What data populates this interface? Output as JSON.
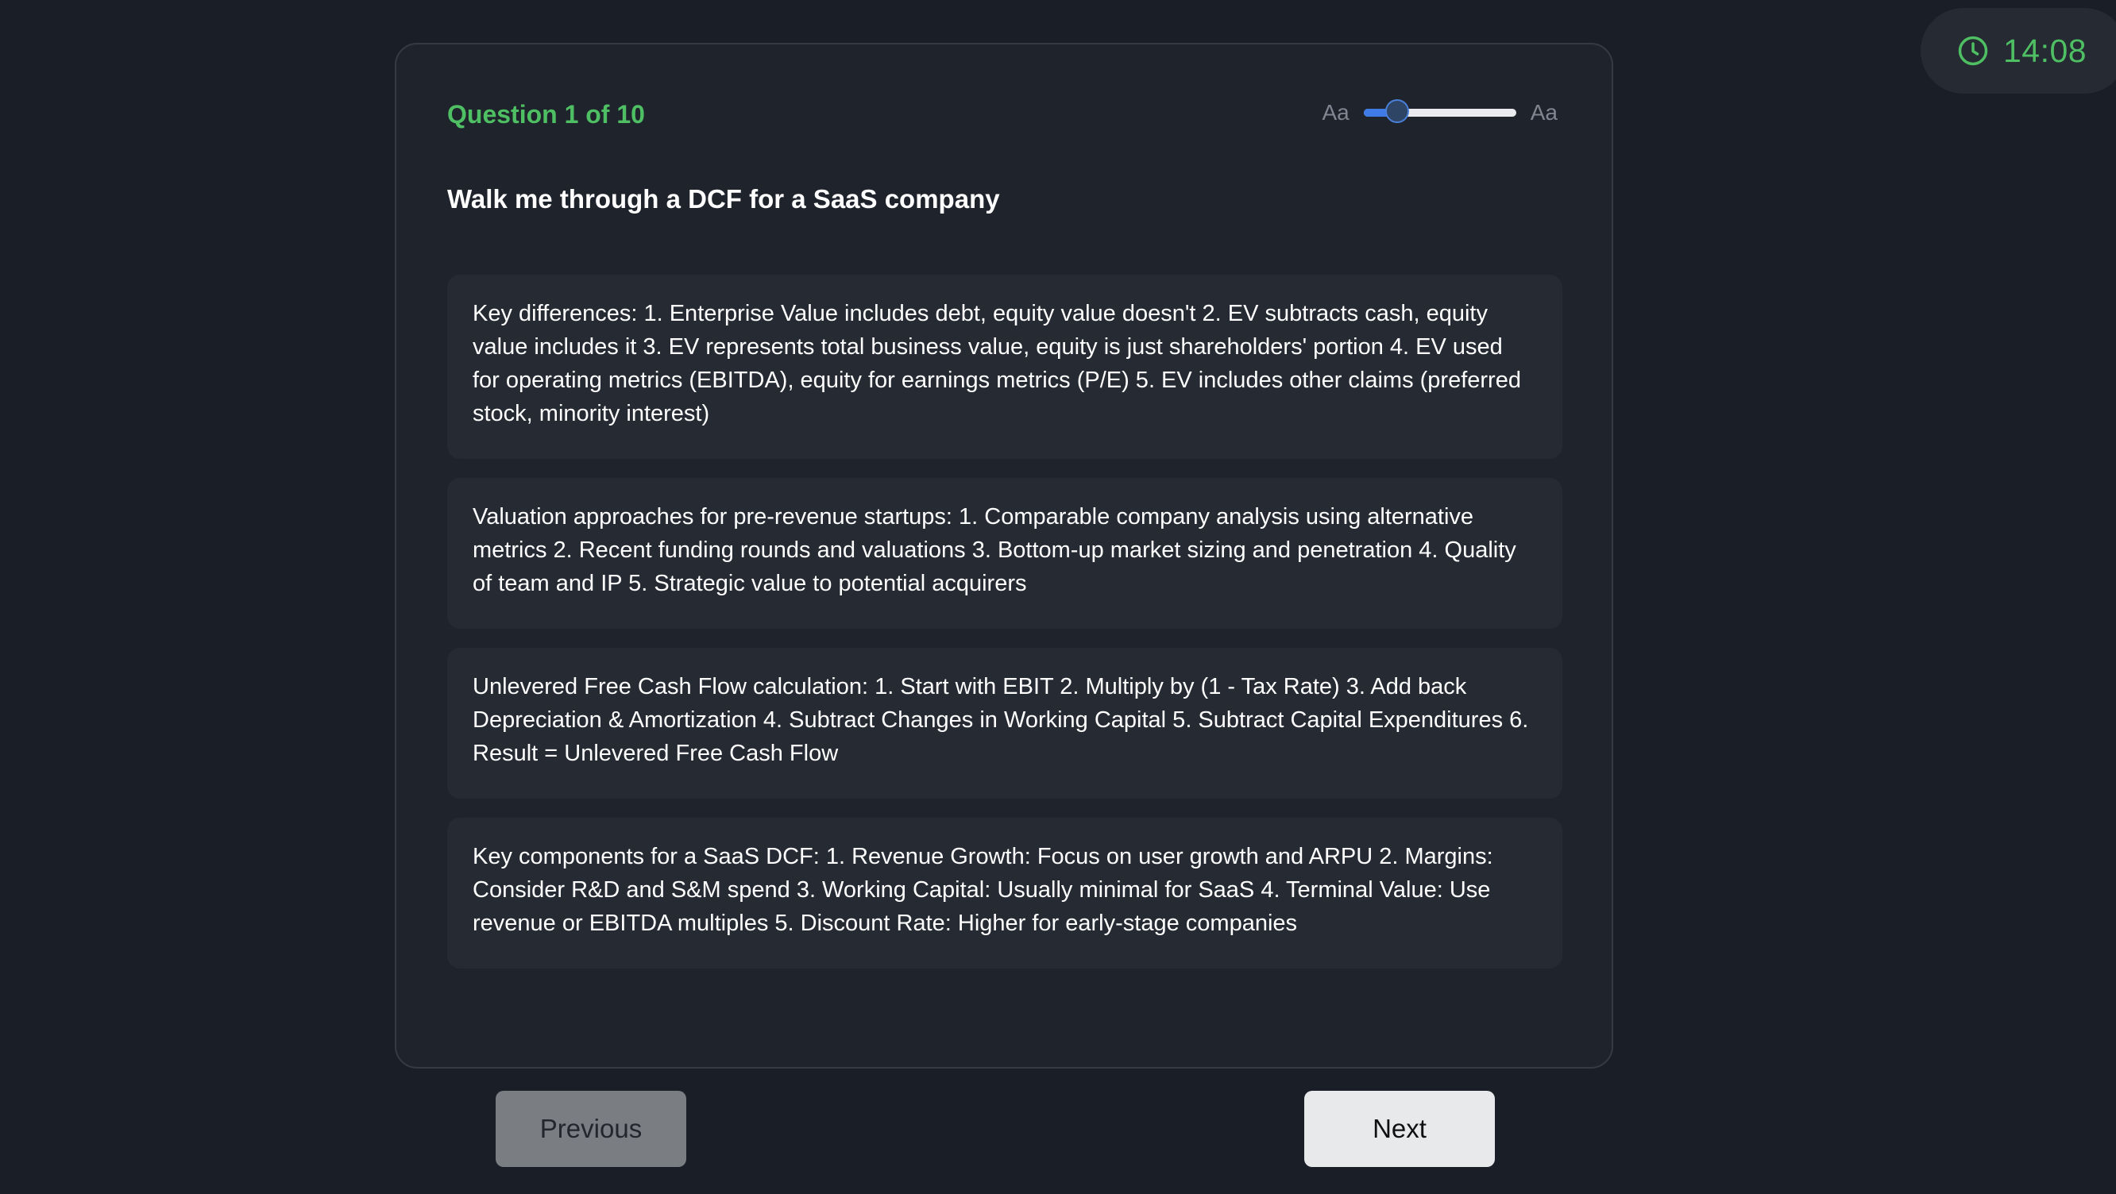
{
  "timer": {
    "time": "14:08",
    "icon": "clock-icon",
    "color": "#4fbf63"
  },
  "quiz": {
    "counter": "Question 1 of 10",
    "question": "Walk me through a DCF for a SaaS company",
    "font_size_control": {
      "small_label": "Aa",
      "large_label": "Aa",
      "level": 0.15
    },
    "options": [
      {
        "text": "Key differences: 1. Enterprise Value includes debt, equity value doesn't 2. EV subtracts cash, equity value includes it 3. EV represents total business value, equity is just shareholders' portion 4. EV used for operating metrics (EBITDA), equity for earnings metrics (P/E) 5. EV includes other claims (preferred stock, minority interest)"
      },
      {
        "text": "Valuation approaches for pre-revenue startups: 1. Comparable company analysis using alternative metrics 2. Recent funding rounds and valuations 3. Bottom-up market sizing and penetration 4. Quality of team and IP 5. Strategic value to potential acquirers"
      },
      {
        "text": "Unlevered Free Cash Flow calculation: 1. Start with EBIT 2. Multiply by (1 - Tax Rate) 3. Add back Depreciation & Amortization 4. Subtract Changes in Working Capital 5. Subtract Capital Expenditures 6. Result = Unlevered Free Cash Flow"
      },
      {
        "text": "Key components for a SaaS DCF: 1. Revenue Growth: Focus on user growth and ARPU 2. Margins: Consider R&D and S&M spend 3. Working Capital: Usually minimal for SaaS 4. Terminal Value: Use revenue or EBITDA multiples 5. Discount Rate: Higher for early-stage companies"
      }
    ]
  },
  "nav": {
    "previous_label": "Previous",
    "next_label": "Next"
  },
  "colors": {
    "background": "#1a1e26",
    "card": "#1f232c",
    "option": "#252a33",
    "accent_green": "#4fbf63",
    "slider_blue": "#3f7be6"
  }
}
